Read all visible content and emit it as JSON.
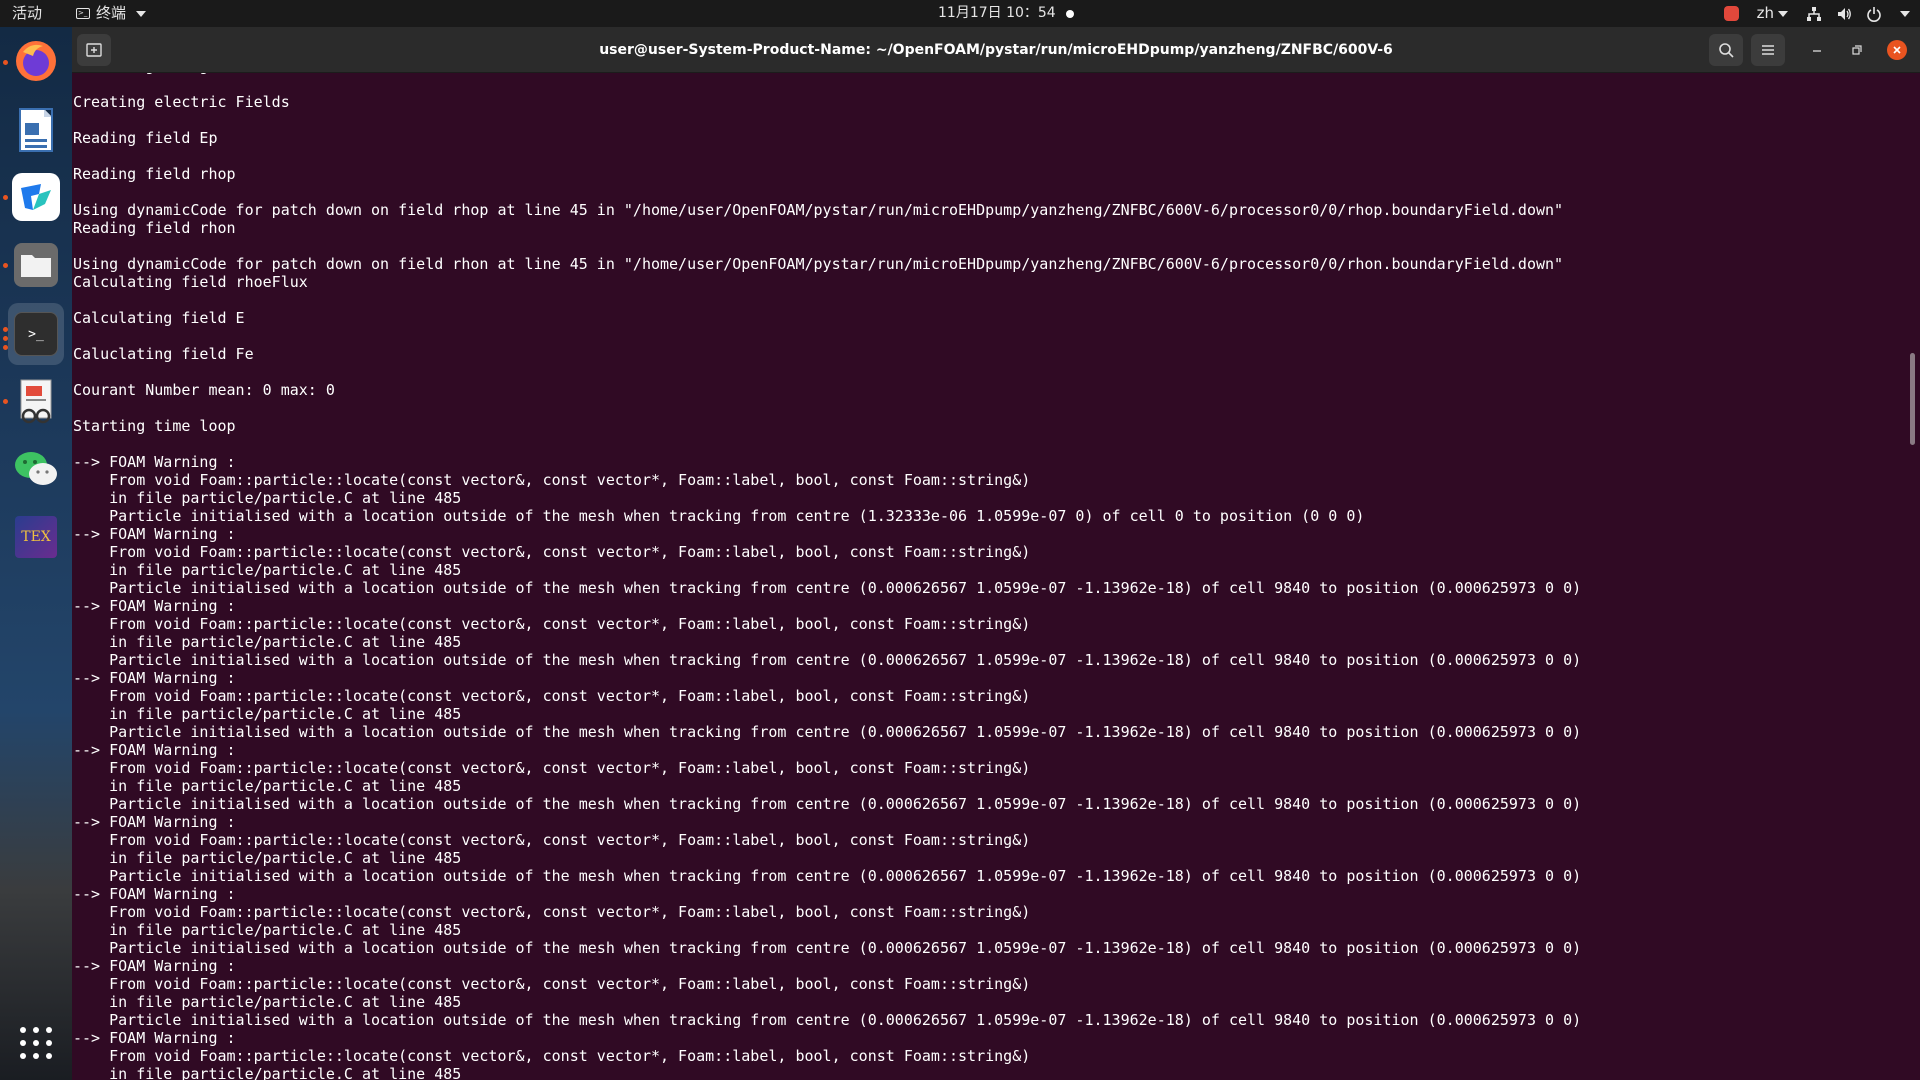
{
  "topbar": {
    "activities": "活动",
    "app_name": "终端",
    "datetime": "11月17日  10：54",
    "lang": "zh"
  },
  "dock": {
    "items": [
      {
        "name": "firefox",
        "icon": "firefox-icon"
      },
      {
        "name": "writer",
        "icon": "libreoffice-writer-icon"
      },
      {
        "name": "feishu",
        "icon": "feishu-icon"
      },
      {
        "name": "files",
        "icon": "files-icon"
      },
      {
        "name": "terminal",
        "icon": "terminal-icon"
      },
      {
        "name": "document-viewer",
        "icon": "document-viewer-icon"
      },
      {
        "name": "wechat",
        "icon": "wechat-icon"
      },
      {
        "name": "texstudio",
        "icon": "tex-icon"
      }
    ],
    "tex_label": "TEX"
  },
  "window": {
    "title": "user@user-System-Product-Name: ~/OpenFOAM/pystar/run/microEHDpump/yanzheng/ZNFBC/600V-6"
  },
  "terminal": {
    "lines": [
      "    ating charge fields",
      "",
      "Creating electric Fields",
      "",
      "Reading field Ep",
      "",
      "Reading field rhop",
      "",
      "Using dynamicCode for patch down on field rhop at line 45 in \"/home/user/OpenFOAM/pystar/run/microEHDpump/yanzheng/ZNFBC/600V-6/processor0/0/rhop.boundaryField.down\"",
      "Reading field rhon",
      "",
      "Using dynamicCode for patch down on field rhon at line 45 in \"/home/user/OpenFOAM/pystar/run/microEHDpump/yanzheng/ZNFBC/600V-6/processor0/0/rhon.boundaryField.down\"",
      "Calculating field rhoeFlux",
      "",
      "Calculating field E",
      "",
      "Caluclating field Fe",
      "",
      "Courant Number mean: 0 max: 0",
      "",
      "Starting time loop",
      "",
      "--> FOAM Warning :",
      "    From void Foam::particle::locate(const vector&, const vector*, Foam::label, bool, const Foam::string&)",
      "    in file particle/particle.C at line 485",
      "    Particle initialised with a location outside of the mesh when tracking from centre (1.32333e-06 1.0599e-07 0) of cell 0 to position (0 0 0)",
      "--> FOAM Warning :",
      "    From void Foam::particle::locate(const vector&, const vector*, Foam::label, bool, const Foam::string&)",
      "    in file particle/particle.C at line 485",
      "    Particle initialised with a location outside of the mesh when tracking from centre (0.000626567 1.0599e-07 -1.13962e-18) of cell 9840 to position (0.000625973 0 0)",
      "--> FOAM Warning :",
      "    From void Foam::particle::locate(const vector&, const vector*, Foam::label, bool, const Foam::string&)",
      "    in file particle/particle.C at line 485",
      "    Particle initialised with a location outside of the mesh when tracking from centre (0.000626567 1.0599e-07 -1.13962e-18) of cell 9840 to position (0.000625973 0 0)",
      "--> FOAM Warning :",
      "    From void Foam::particle::locate(const vector&, const vector*, Foam::label, bool, const Foam::string&)",
      "    in file particle/particle.C at line 485",
      "    Particle initialised with a location outside of the mesh when tracking from centre (0.000626567 1.0599e-07 -1.13962e-18) of cell 9840 to position (0.000625973 0 0)",
      "--> FOAM Warning :",
      "    From void Foam::particle::locate(const vector&, const vector*, Foam::label, bool, const Foam::string&)",
      "    in file particle/particle.C at line 485",
      "    Particle initialised with a location outside of the mesh when tracking from centre (0.000626567 1.0599e-07 -1.13962e-18) of cell 9840 to position (0.000625973 0 0)",
      "--> FOAM Warning :",
      "    From void Foam::particle::locate(const vector&, const vector*, Foam::label, bool, const Foam::string&)",
      "    in file particle/particle.C at line 485",
      "    Particle initialised with a location outside of the mesh when tracking from centre (0.000626567 1.0599e-07 -1.13962e-18) of cell 9840 to position (0.000625973 0 0)",
      "--> FOAM Warning :",
      "    From void Foam::particle::locate(const vector&, const vector*, Foam::label, bool, const Foam::string&)",
      "    in file particle/particle.C at line 485",
      "    Particle initialised with a location outside of the mesh when tracking from centre (0.000626567 1.0599e-07 -1.13962e-18) of cell 9840 to position (0.000625973 0 0)",
      "--> FOAM Warning :",
      "    From void Foam::particle::locate(const vector&, const vector*, Foam::label, bool, const Foam::string&)",
      "    in file particle/particle.C at line 485",
      "    Particle initialised with a location outside of the mesh when tracking from centre (0.000626567 1.0599e-07 -1.13962e-18) of cell 9840 to position (0.000625973 0 0)",
      "--> FOAM Warning :",
      "    From void Foam::particle::locate(const vector&, const vector*, Foam::label, bool, const Foam::string&)",
      "    in file particle/particle.C at line 485"
    ]
  },
  "colors": {
    "terminal_bg": "#300a24",
    "terminal_fg": "#ffffff",
    "accent": "#e95420",
    "topbar_bg": "#1a1a1a",
    "headerbar_bg": "#2b2b2b"
  }
}
